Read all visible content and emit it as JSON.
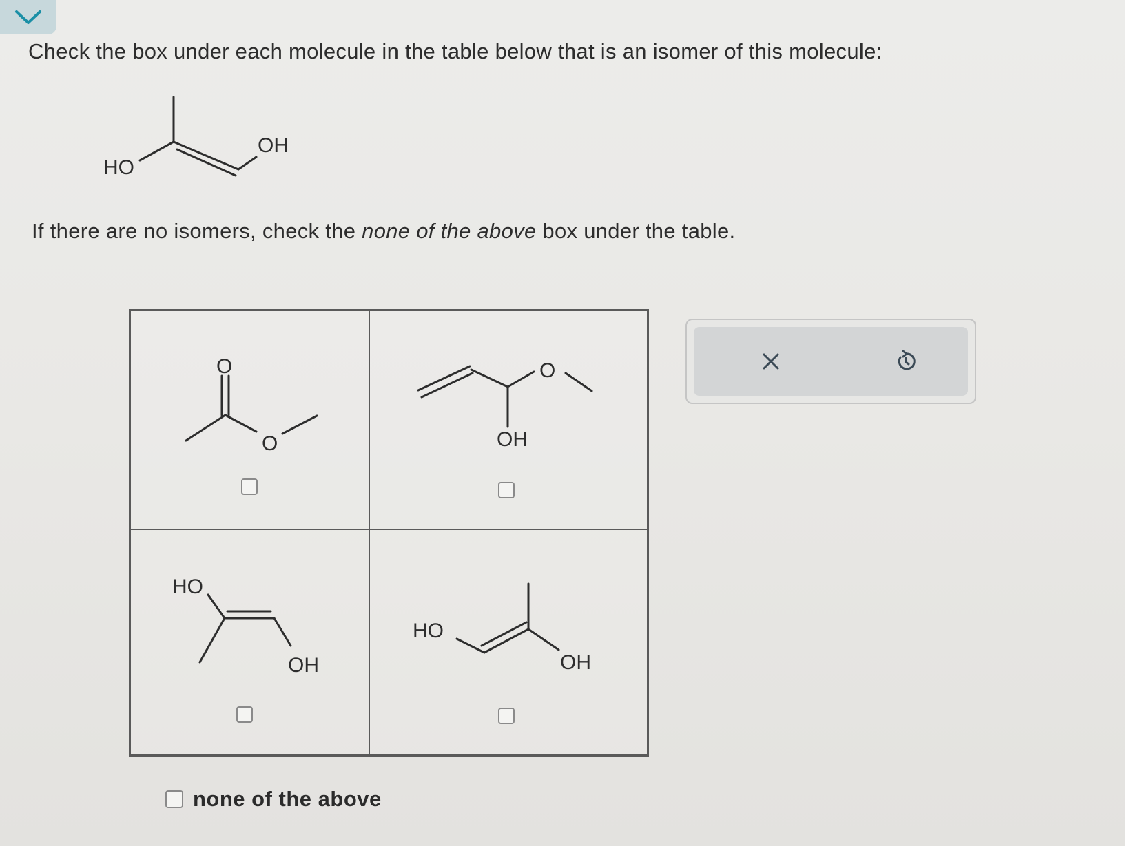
{
  "question": {
    "prompt": "Check the box under each molecule in the table below that is an isomer of this molecule:",
    "instruction_before": "If there are no isomers, check the ",
    "instruction_emphasis": "none of the above",
    "instruction_after": " box under the table."
  },
  "target_molecule": {
    "labels": [
      "HO",
      "OH"
    ]
  },
  "options": [
    {
      "labels": [
        "O",
        "O"
      ],
      "checked": false
    },
    {
      "labels": [
        "O",
        "OH"
      ],
      "checked": false
    },
    {
      "labels": [
        "HO",
        "OH"
      ],
      "checked": false
    },
    {
      "labels": [
        "HO",
        "OH"
      ],
      "checked": false
    }
  ],
  "none_option": {
    "label": "none of the above",
    "checked": false
  },
  "actions": {
    "clear_icon": "close-icon",
    "undo_icon": "undo-icon"
  },
  "colors": {
    "accent": "#1a8fa6",
    "tab_bg": "#c7d8dc",
    "ink": "#2d2d2d"
  }
}
